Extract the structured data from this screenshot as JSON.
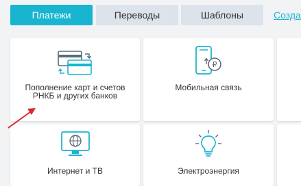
{
  "tabs": {
    "payments": "Платежи",
    "transfers": "Переводы",
    "templates": "Шаблоны",
    "create": "Созда"
  },
  "tiles": {
    "cards": {
      "line1": "Пополнение карт и счетов",
      "line2": "РНКБ и других банков",
      "icon": "cards-transfer-icon"
    },
    "mobile": {
      "label": "Мобильная связь",
      "icon": "mobile-payment-icon"
    },
    "internet": {
      "label": "Интернет и ТВ",
      "icon": "monitor-globe-icon"
    },
    "electricity": {
      "label": "Электроэнергия",
      "icon": "lightbulb-icon"
    }
  },
  "colors": {
    "accent": "#19b5d0",
    "inactive_tab": "#dde3ea",
    "annotation_arrow": "#d9262c"
  }
}
